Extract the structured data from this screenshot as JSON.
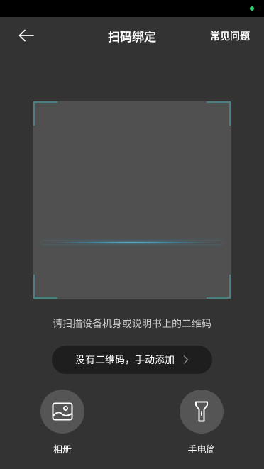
{
  "nav": {
    "title": "扫码绑定",
    "faq_label": "常见问题"
  },
  "scan": {
    "hint": "请扫描设备机身或说明书上的二维码"
  },
  "manual_add": {
    "label": "没有二维码，手动添加"
  },
  "actions": {
    "album_label": "相册",
    "flashlight_label": "手电筒"
  },
  "icons": {
    "back": "arrow-left-icon",
    "chevron": "chevron-right-icon",
    "album": "image-icon",
    "flashlight": "flashlight-icon"
  },
  "colors": {
    "background": "#333333",
    "scan_area": "#505050",
    "corner": "#4a7f84",
    "scan_line": "#4aa3c6",
    "status_indicator": "#2fd66b"
  }
}
